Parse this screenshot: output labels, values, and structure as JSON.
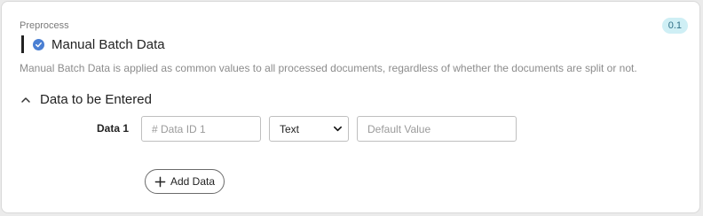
{
  "section": {
    "label": "Preprocess",
    "version": "0.1"
  },
  "header": {
    "title": "Manual Batch Data",
    "icon": "check-circle-icon",
    "accent_color": "#4a7fd3"
  },
  "description": "Manual Batch Data is applied as common values to all processed documents, regardless of whether the documents are split or not.",
  "group": {
    "title": "Data to be Entered",
    "expanded": true,
    "icon": "chevron-up-icon"
  },
  "rows": [
    {
      "label": "Data 1",
      "id_placeholder": "# Data ID 1",
      "id_value": "",
      "type_value": "Text",
      "default_placeholder": "Default Value",
      "default_value": ""
    }
  ],
  "add_button": {
    "label": "Add Data",
    "icon": "plus-icon"
  }
}
